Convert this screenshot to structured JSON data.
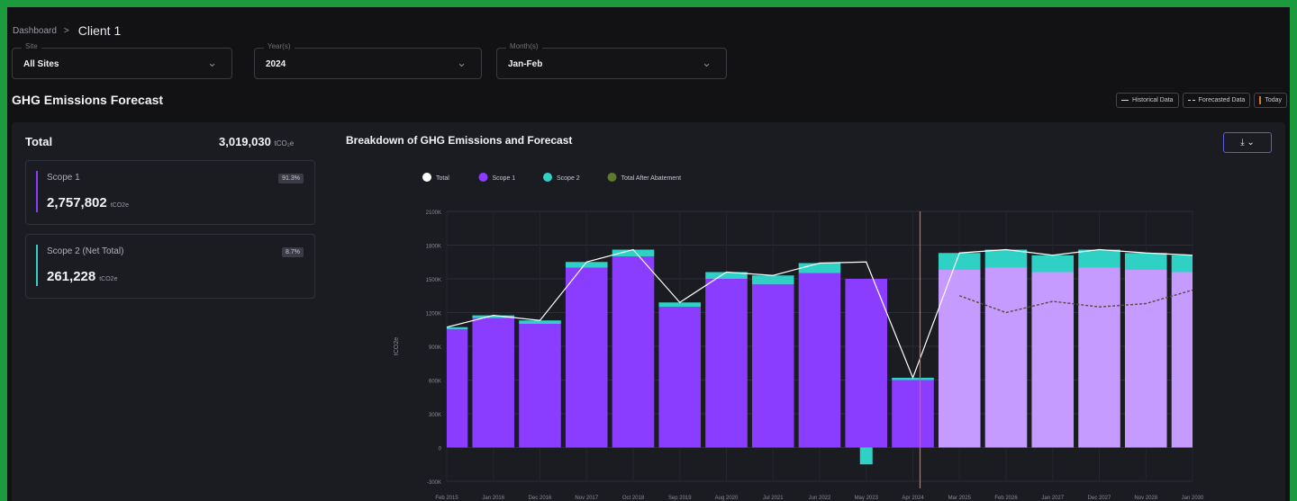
{
  "breadcrumb": {
    "parent": "Dashboard",
    "separator": ">",
    "current": "Client 1"
  },
  "filters": [
    {
      "label": "Site",
      "value": "All Sites"
    },
    {
      "label": "Year(s)",
      "value": "2024"
    },
    {
      "label": "Month(s)",
      "value": "Jan-Feb"
    }
  ],
  "page_title": "GHG Emissions Forecast",
  "legend_buttons": {
    "historical": "Historical Data",
    "forecasted": "Forecasted Data",
    "today": "Today"
  },
  "totals": {
    "label": "Total",
    "value": "3,019,030",
    "unit": "tCO₂e"
  },
  "scopes": [
    {
      "name": "Scope 1",
      "value": "2,757,802",
      "unit": "tCO2e",
      "pct": "91.3%",
      "color": "#8b3dff"
    },
    {
      "name": "Scope 2 (Net Total)",
      "value": "261,228",
      "unit": "tCO2e",
      "pct": "8.7%",
      "color": "#2fd1c4"
    }
  ],
  "export_button": {
    "icon": "download-icon",
    "chevron": "chevron-down-icon"
  },
  "colors": {
    "scope1": "#8b3dff",
    "scope1_forecast": "#c69bff",
    "scope2": "#2fd1c4",
    "total": "#ffffff",
    "abatement": "#5b7a2a",
    "today": "#e0701c",
    "background": "#121214"
  },
  "chart_data": {
    "type": "area",
    "title": "Breakdown of GHG Emissions and Forecast",
    "ylabel": "tCO2e",
    "legend": [
      "Total",
      "Scope 1",
      "Scope 2",
      "Total After Abatement"
    ],
    "y_ticks": [
      "-300K",
      "0",
      "300K",
      "600K",
      "900K",
      "1200K",
      "1500K",
      "1800K",
      "2100K"
    ],
    "x_ticks": [
      "Feb 2015",
      "Jan 2016",
      "Dec 2016",
      "Nov 2017",
      "Oct 2018",
      "Sep 2019",
      "Aug 2020",
      "Jul 2021",
      "Jun 2022",
      "May 2023",
      "Apr 2024",
      "Mar 2025",
      "Feb 2026",
      "Jan 2027",
      "Dec 2027",
      "Nov 2028",
      "Jan 2030"
    ],
    "ylim": [
      -300000,
      2100000
    ],
    "today": "Apr 2024",
    "x": [
      "Feb 2015",
      "Jan 2016",
      "Dec 2016",
      "Nov 2017",
      "Oct 2018",
      "Sep 2019",
      "Aug 2020",
      "Jul 2021",
      "Jun 2022",
      "May 2023",
      "Apr 2024",
      "Mar 2025",
      "Feb 2026",
      "Jan 2027",
      "Dec 2027",
      "Nov 2028",
      "Jan 2030"
    ],
    "series": [
      {
        "name": "Scope 1",
        "values": [
          1050000,
          1150000,
          1100000,
          1600000,
          1700000,
          1250000,
          1500000,
          1450000,
          1550000,
          1500000,
          600000,
          1580000,
          1600000,
          1560000,
          1600000,
          1580000,
          1560000
        ]
      },
      {
        "name": "Scope 2",
        "values": [
          20000,
          25000,
          30000,
          50000,
          60000,
          40000,
          60000,
          80000,
          90000,
          -150000,
          20000,
          150000,
          160000,
          150000,
          160000,
          150000,
          150000
        ]
      },
      {
        "name": "Total",
        "values": [
          1070000,
          1175000,
          1130000,
          1650000,
          1760000,
          1290000,
          1560000,
          1530000,
          1640000,
          1650000,
          620000,
          1730000,
          1760000,
          1710000,
          1760000,
          1730000,
          1710000
        ]
      },
      {
        "name": "Total After Abatement",
        "values": [
          null,
          null,
          null,
          null,
          null,
          null,
          null,
          null,
          null,
          null,
          null,
          1350000,
          1200000,
          1300000,
          1250000,
          1280000,
          1400000
        ]
      }
    ]
  }
}
